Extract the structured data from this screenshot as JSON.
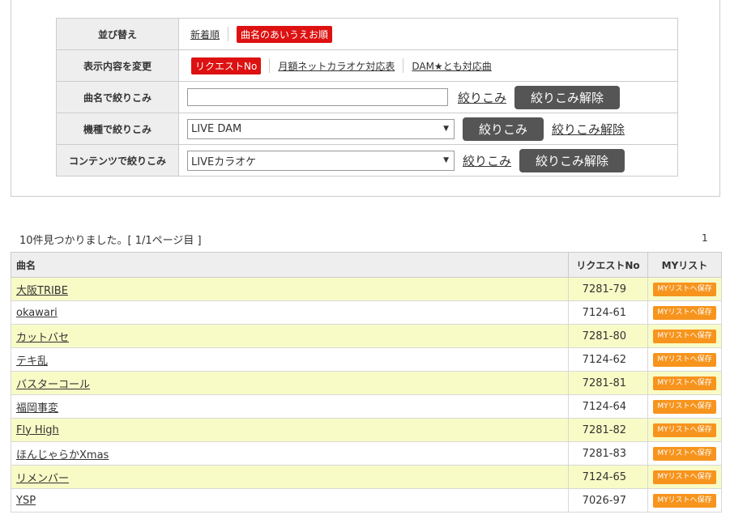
{
  "filters": {
    "sort": {
      "label": "並び替え",
      "options": [
        "新着順",
        "曲名のあいうえお順"
      ],
      "selected": "曲名のあいうえお順"
    },
    "display": {
      "label": "表示内容を変更",
      "options": [
        "リクエストNo",
        "月額ネットカラオケ対応表",
        "DAM★とも対応曲"
      ],
      "selected": "リクエストNo"
    },
    "song_name": {
      "label": "曲名で絞りこみ",
      "value": "",
      "apply": "絞りこみ",
      "clear": "絞りこみ解除"
    },
    "model": {
      "label": "機種で絞りこみ",
      "value": "LIVE DAM",
      "apply": "絞りこみ",
      "clear": "絞りこみ解除"
    },
    "content": {
      "label": "コンテンツで絞りこみ",
      "value": "LIVEカラオケ",
      "apply": "絞りこみ",
      "clear": "絞りこみ解除"
    }
  },
  "summary": "10件見つかりました。[ 1/1ページ目 ]",
  "page": "1",
  "table": {
    "headers": [
      "曲名",
      "リクエストNo",
      "MYリスト"
    ],
    "save_label": "MYリストへ保存",
    "rows": [
      {
        "title": "大阪TRIBE",
        "request_no": "7281-79"
      },
      {
        "title": "okawari",
        "request_no": "7124-61"
      },
      {
        "title": "カットバセ",
        "request_no": "7281-80"
      },
      {
        "title": "テキ乱",
        "request_no": "7124-62"
      },
      {
        "title": "バスターコール",
        "request_no": "7281-81"
      },
      {
        "title": "福岡事変",
        "request_no": "7124-64"
      },
      {
        "title": "Fly High",
        "request_no": "7281-82"
      },
      {
        "title": "ほんじゃらかXmas",
        "request_no": "7281-83"
      },
      {
        "title": "リメンバー",
        "request_no": "7124-65"
      },
      {
        "title": "YSP",
        "request_no": "7026-97"
      }
    ]
  },
  "colors": {
    "highlight_row": "#f8fbc6",
    "badge_red": "#dd1111",
    "save_orange": "#f7941d",
    "button_dark": "#555555"
  }
}
